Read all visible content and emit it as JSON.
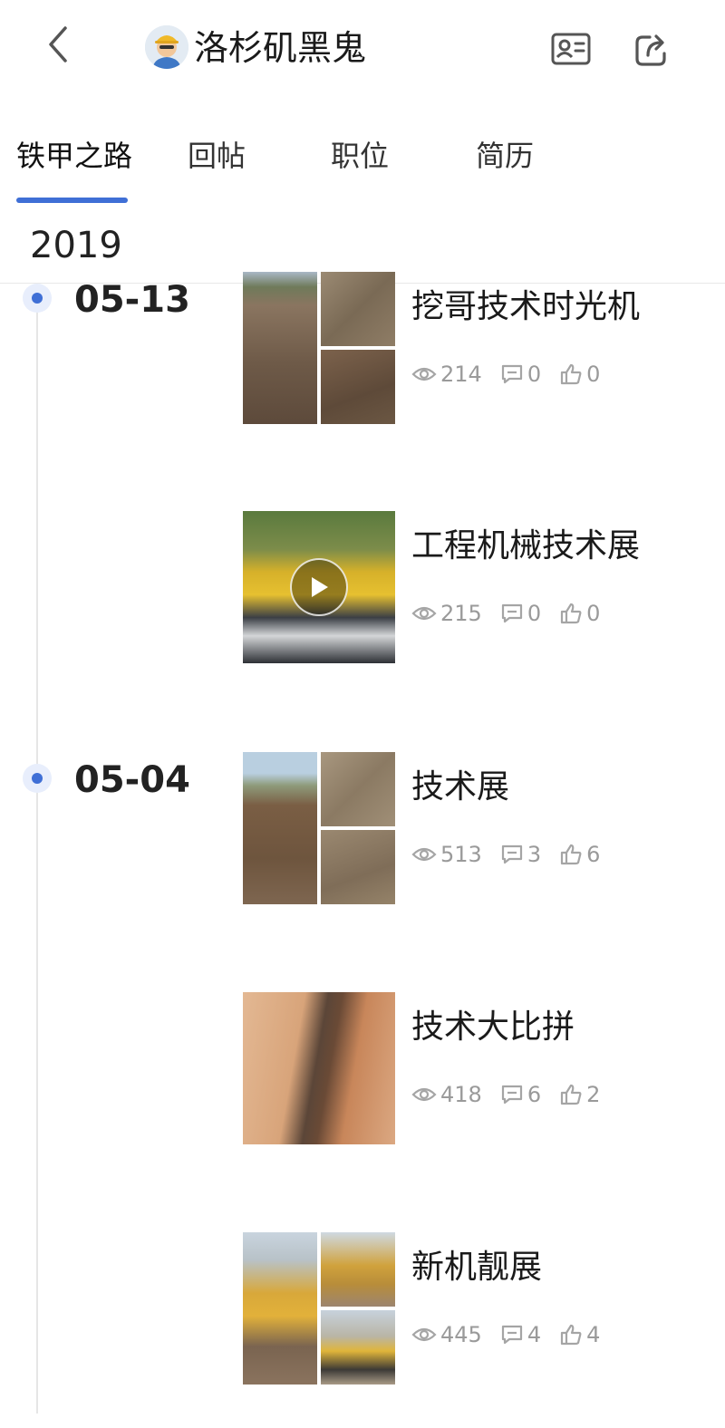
{
  "header": {
    "username": "洛杉矶黑鬼",
    "back_icon": "chevron-left-icon",
    "card_icon": "id-card-icon",
    "share_icon": "share-icon"
  },
  "tabs": [
    {
      "label": "铁甲之路",
      "active": true
    },
    {
      "label": "回帖",
      "active": false
    },
    {
      "label": "职位",
      "active": false
    },
    {
      "label": "简历",
      "active": false
    }
  ],
  "accent_color": "#3f6fd6",
  "year": "2019",
  "groups": [
    {
      "date": "05-13"
    },
    {
      "date": "05-04"
    }
  ],
  "posts": [
    {
      "title": "挖哥技术时光机",
      "views": "214",
      "comments": "0",
      "likes": "0",
      "media": "image-grid"
    },
    {
      "title": "工程机械技术展",
      "views": "215",
      "comments": "0",
      "likes": "0",
      "media": "video"
    },
    {
      "title": "技术展",
      "views": "513",
      "comments": "3",
      "likes": "6",
      "media": "image-grid"
    },
    {
      "title": "技术大比拼",
      "views": "418",
      "comments": "6",
      "likes": "2",
      "media": "image"
    },
    {
      "title": "新机靓展",
      "views": "445",
      "comments": "4",
      "likes": "4",
      "media": "image-grid"
    }
  ]
}
